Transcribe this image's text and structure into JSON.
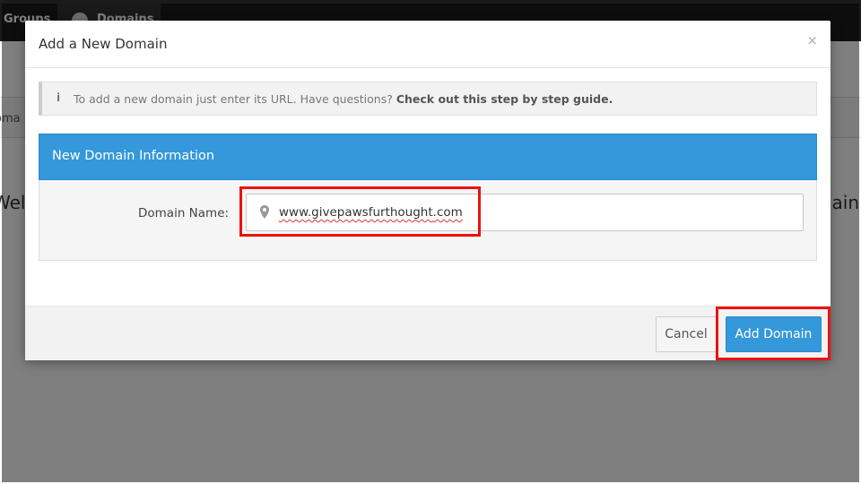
{
  "background": {
    "nav": {
      "groups": "Groups",
      "domains": "Domains"
    },
    "subbar_text": "oma",
    "welcome_left": "Welc",
    "welcome_right": "ain"
  },
  "modal": {
    "title": "Add a New Domain",
    "close_glyph": "×",
    "info": {
      "icon_glyph": "i",
      "text": "To add a new domain just enter its URL. Have questions?",
      "link": "Check out this step by step guide."
    },
    "panel": {
      "title": "New Domain Information",
      "field_label": "Domain Name:",
      "domain_value": "www.givepawsfurthought",
      "domain_tld": ".com"
    },
    "footer": {
      "cancel_label": "Cancel",
      "add_label": "Add Domain"
    }
  },
  "colors": {
    "accent": "#3498db",
    "highlight": "#ee1111"
  },
  "icons": [
    "close-icon",
    "info-icon",
    "map-pin-icon",
    "globe-icon"
  ]
}
